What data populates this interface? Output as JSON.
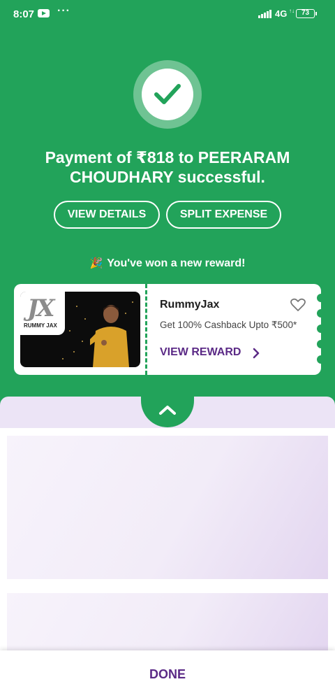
{
  "status_bar": {
    "time": "8:07",
    "dots": "···",
    "network": "4G",
    "data_arrows": "↑↓",
    "battery": "73"
  },
  "payment": {
    "message": "Payment of ₹818 to PEERARAM CHOUDHARY successful.",
    "view_details_label": "VIEW DETAILS",
    "split_expense_label": "SPLIT EXPENSE"
  },
  "reward": {
    "banner": "You've won a new reward!",
    "party_icon": "🎉",
    "brand_logo_text": "RUMMY JAX",
    "brand_logo_mark": "JX",
    "name": "RummyJax",
    "description": "Get 100% Cashback Upto ₹500*",
    "cta_label": "VIEW REWARD"
  },
  "footer": {
    "done_label": "DONE"
  },
  "colors": {
    "primary_green": "#22a35a",
    "brand_purple": "#5b2a86",
    "lavender": "#ece4f6"
  }
}
